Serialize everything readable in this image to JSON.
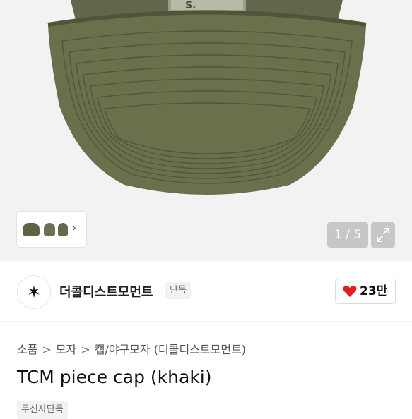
{
  "gallery": {
    "counter": "1 / 5",
    "next_thumbs_label": "›",
    "expand_icon": "expand-icon",
    "product_label": "S."
  },
  "store": {
    "logo_icon": "star-logo-icon",
    "logo_glyph": "✶",
    "name": "더콜디스트모먼트",
    "badge": "단독",
    "like_count": "23만",
    "like_icon": "heart-icon",
    "heart_color": "#e02020"
  },
  "breadcrumb": {
    "items": [
      "소품",
      "모자",
      "캡/야구모자 (더콜디스트모먼트)"
    ],
    "separator": ">"
  },
  "product": {
    "title": "TCM piece cap (khaki)",
    "tag": "무신사단독"
  },
  "colors": {
    "cap_khaki": "#6b6f4c",
    "cap_dark": "#50553a"
  }
}
